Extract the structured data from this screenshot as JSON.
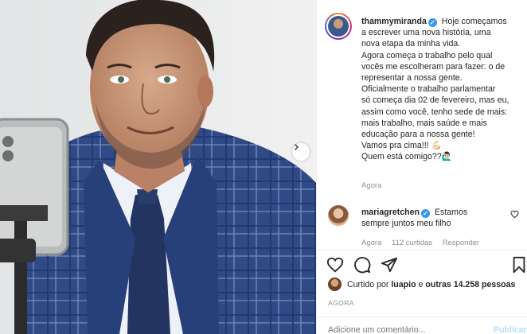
{
  "post": {
    "username": "thammymiranda",
    "caption_lines": [
      "Hoje começamos",
      "a escrever uma nova história, uma",
      "nova etapa da minha vida.",
      "Agora começa o trabalho pelo qual",
      "vocês me escolheram para fazer: o de",
      "representar a nossa gente.",
      "Oficialmente o trabalho parlamentar",
      "só começa dia 02 de fevereiro, mas eu,",
      "assim como você, tenho sede de mais:",
      "mais trabalho, mais saúde e mais",
      "educação para a nossa gente!",
      "Vamos pra cima!!! 💪🏻",
      "Quem está comigo??🙋🏻‍♂️"
    ],
    "time": "Agora"
  },
  "comment": {
    "username": "mariagretchen",
    "text_lines": [
      "Estamos",
      "sempre juntos meu filho"
    ],
    "time": "Agora",
    "likes": "112 curtidas",
    "reply": "Responder"
  },
  "likes": {
    "prefix": "Curtido por",
    "user": "luapio",
    "middle": "e",
    "others": "outras 14.258 pessoas"
  },
  "timestamp": "AGORA",
  "add_comment": {
    "placeholder": "Adicione um comentário..."
  },
  "publish_label": "Publicar",
  "icons": [
    "heart-icon",
    "comment-icon",
    "share-icon",
    "bookmark-icon",
    "chevron-right-icon",
    "verified-icon"
  ],
  "colors": {
    "accent": "#3897f0",
    "muted": "#8e8e8e",
    "publish": "#b2dffc"
  }
}
